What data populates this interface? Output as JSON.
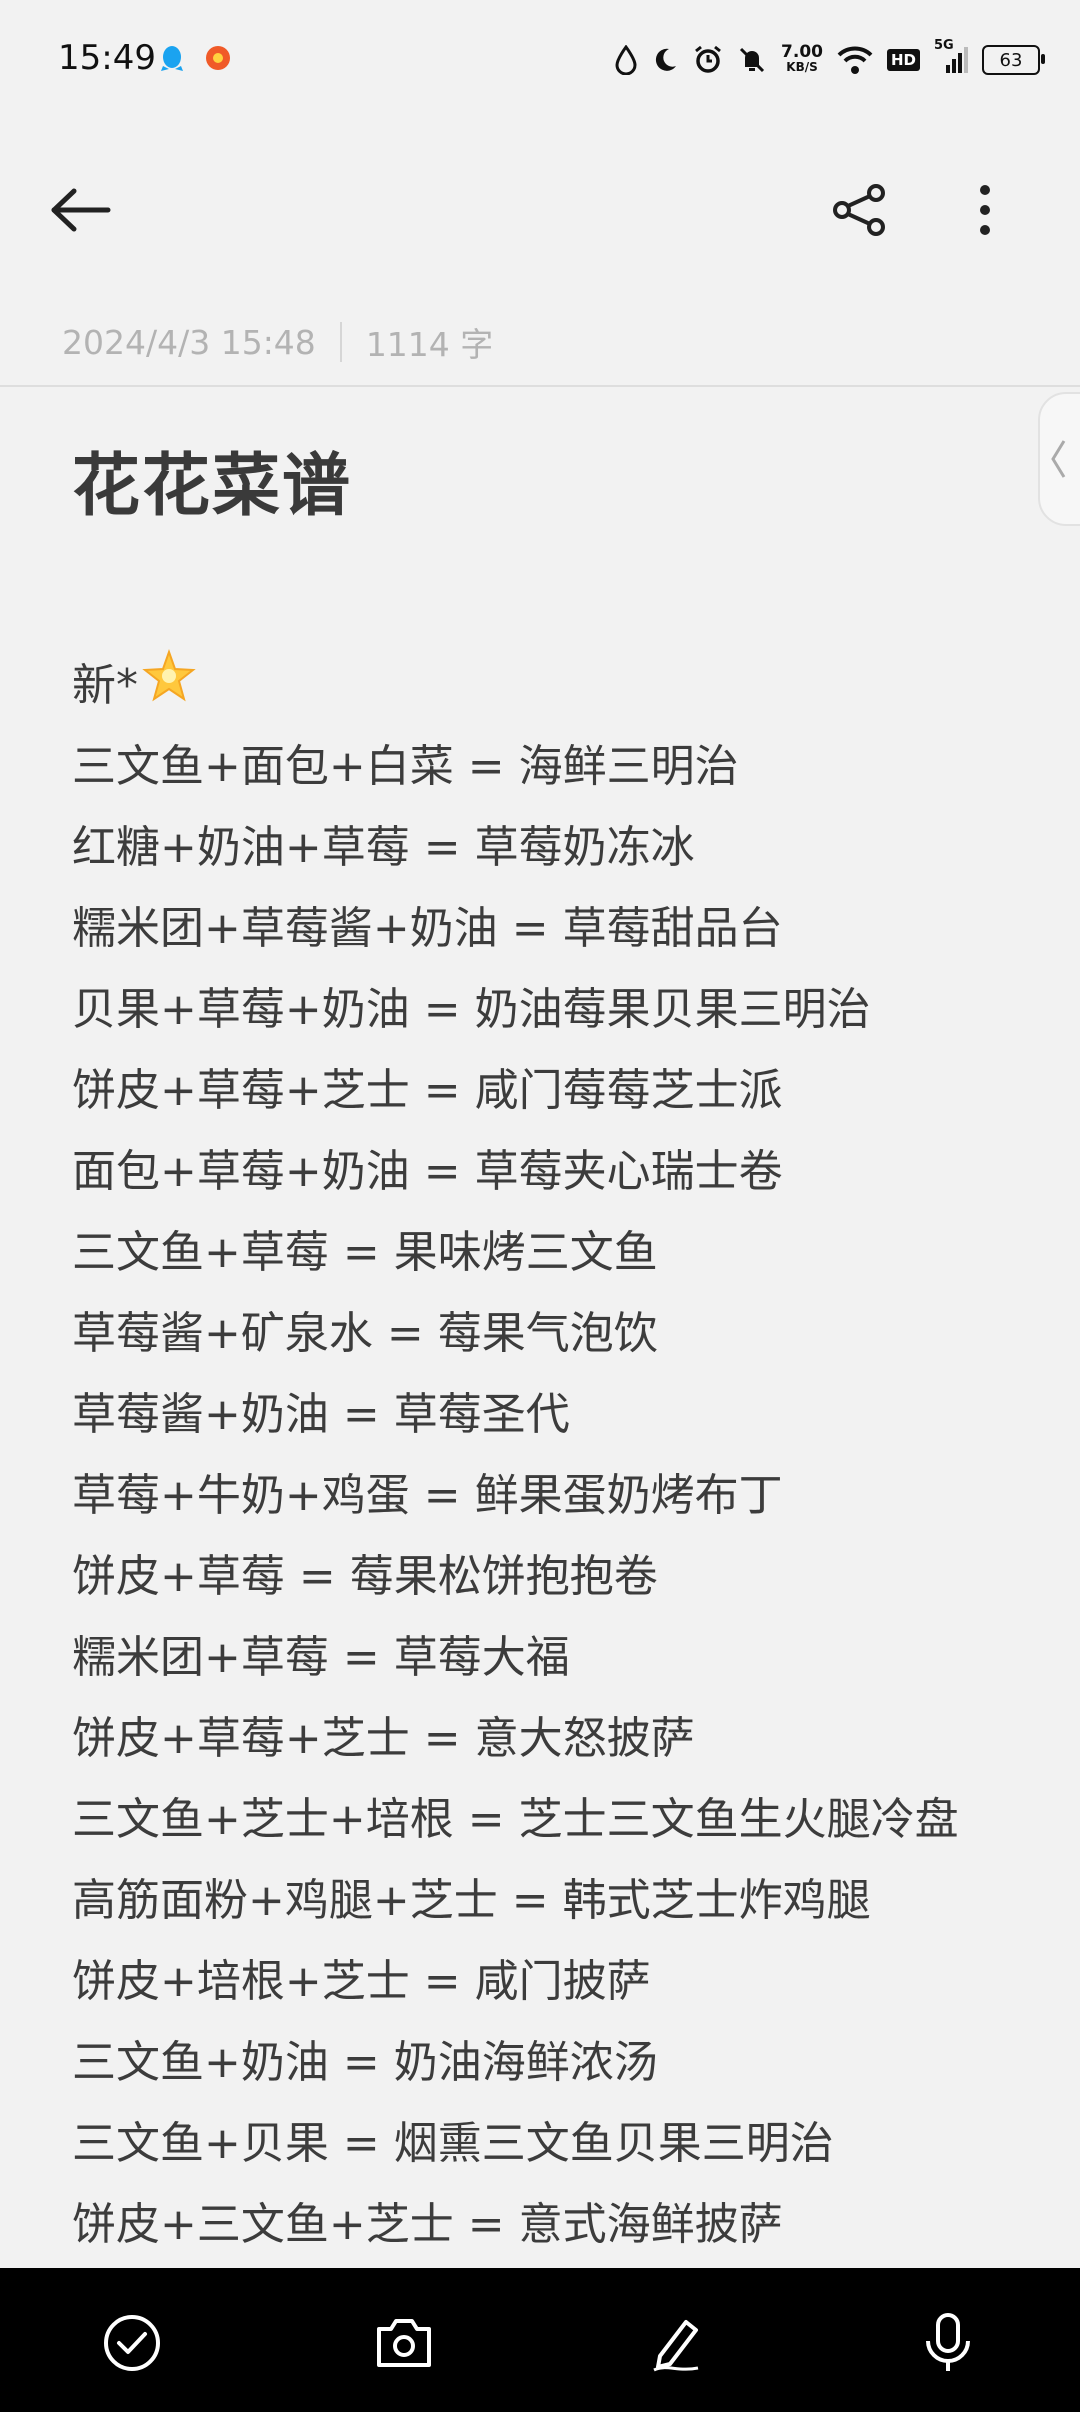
{
  "status_bar": {
    "time": "15:49",
    "speed_value": "7.00",
    "speed_unit": "KB/S",
    "hd_label": "HD",
    "network_label": "5G",
    "battery_level": "63"
  },
  "toolbar": {
    "back_icon": "arrow-left-icon",
    "share_icon": "share-icon",
    "more_icon": "more-vertical-icon"
  },
  "note": {
    "date": "2024/4/3 15:48",
    "word_count": "1114 字",
    "title": "花花菜谱",
    "lines": [
      "新*",
      "三文鱼+面包+白菜 = 海鲜三明治",
      "红糖+奶油+草莓 = 草莓奶冻冰",
      "糯米团+草莓酱+奶油 = 草莓甜品台",
      "贝果+草莓+奶油 = 奶油莓果贝果三明治",
      "饼皮+草莓+芝士 = 咸门莓莓芝士派",
      "面包+草莓+奶油 = 草莓夹心瑞士卷",
      "三文鱼+草莓 = 果味烤三文鱼",
      "草莓酱+矿泉水 = 莓果气泡饮",
      "草莓酱+奶油 = 草莓圣代",
      "草莓+牛奶+鸡蛋 = 鲜果蛋奶烤布丁",
      "饼皮+草莓 = 莓果松饼抱抱卷",
      "糯米团+草莓 = 草莓大福",
      "饼皮+草莓+芝士 = 意大怒披萨",
      "三文鱼+芝士+培根 = 芝士三文鱼生火腿冷盘",
      "高筋面粉+鸡腿+芝士 = 韩式芝士炸鸡腿",
      "饼皮+培根+芝士 = 咸门披萨",
      "三文鱼+奶油 = 奶油海鲜浓汤",
      "三文鱼+贝果 = 烟熏三文鱼贝果三明治",
      "饼皮+三文鱼+芝士 = 意式海鲜披萨"
    ]
  },
  "bottom_bar": {
    "items": [
      "checklist-icon",
      "camera-icon",
      "pen-icon",
      "microphone-icon"
    ]
  }
}
